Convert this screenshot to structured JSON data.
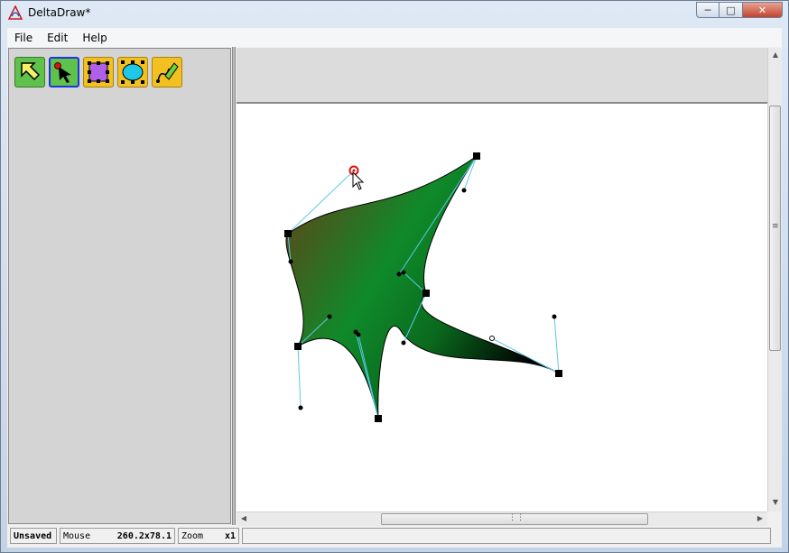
{
  "window": {
    "title": "DeltaDraw*"
  },
  "menu": {
    "items": [
      "File",
      "Edit",
      "Help"
    ]
  },
  "toolbar": {
    "tools": [
      {
        "icon": "select-arrow-icon"
      },
      {
        "icon": "node-edit-icon"
      },
      {
        "icon": "rectangle-icon"
      },
      {
        "icon": "ellipse-icon"
      },
      {
        "icon": "pen-icon"
      }
    ],
    "selected_index": 1
  },
  "status": {
    "saved": "Unsaved",
    "mouse_label": "Mouse",
    "mouse_value": "260.2x78.1",
    "zoom_label": "Zoom",
    "zoom_value": "x1"
  },
  "colors": {
    "shape_gradient_start": "#6b3a14",
    "shape_gradient_mid": "#0f8a2a",
    "shape_gradient_end": "#000000",
    "handle_line": "#5bc8e8",
    "selected_tool_border": "#1a36e0"
  }
}
